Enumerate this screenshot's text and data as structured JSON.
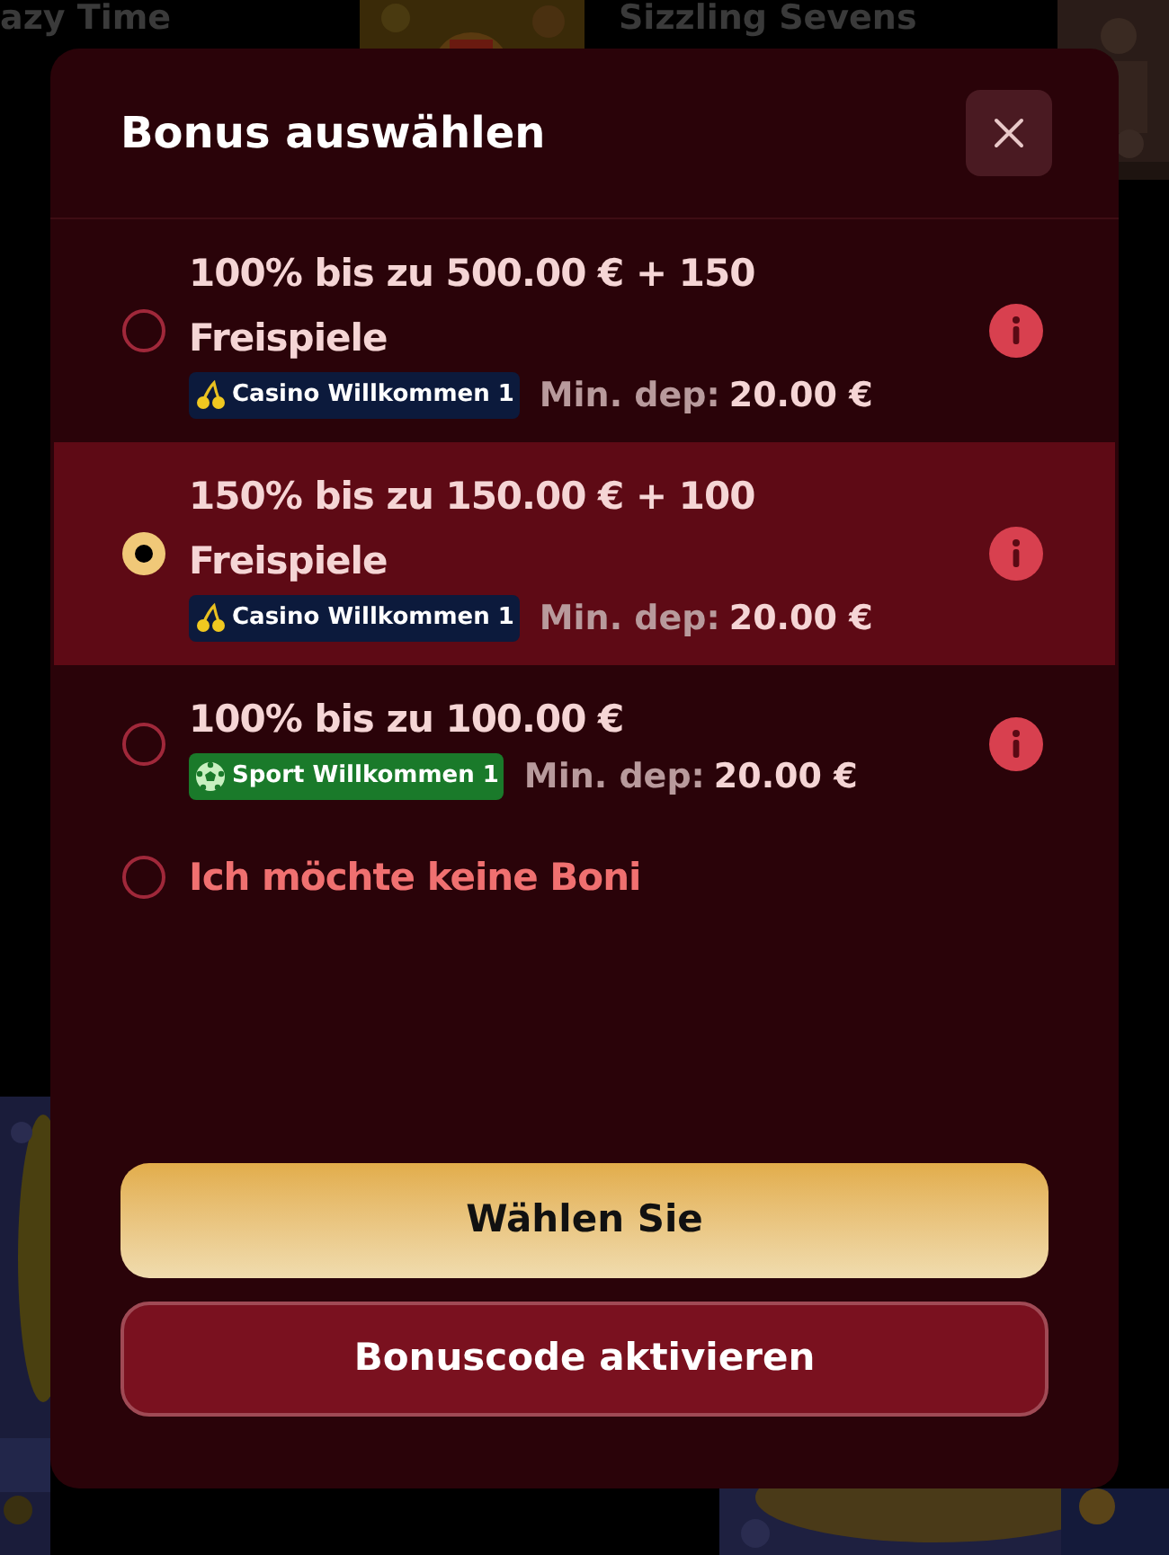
{
  "background": {
    "tiles": [
      {
        "title": "azy Time"
      },
      {
        "title": "Sizzling Sevens"
      }
    ]
  },
  "dialog": {
    "title": "Bonus auswählen",
    "options": [
      {
        "kind": "bonus",
        "selected": false,
        "title": "100% bis zu 500.00 € + 150 Freispiele",
        "tag": {
          "kind": "casino",
          "label": "Casino Willkommen 1"
        },
        "min_deposit_label": "Min. dep:",
        "min_deposit": "20.00 €"
      },
      {
        "kind": "bonus",
        "selected": true,
        "title": "150% bis zu 150.00 € + 100 Freispiele",
        "tag": {
          "kind": "casino",
          "label": "Casino Willkommen 1"
        },
        "min_deposit_label": "Min. dep:",
        "min_deposit": "20.00 €"
      },
      {
        "kind": "bonus",
        "selected": false,
        "title": "100% bis zu 100.00 €",
        "tag": {
          "kind": "sport",
          "label": "Sport Willkommen 1"
        },
        "min_deposit_label": "Min. dep:",
        "min_deposit": "20.00 €"
      },
      {
        "kind": "none",
        "selected": false,
        "title": "Ich möchte keine Boni"
      }
    ],
    "buttons": [
      {
        "kind": "primary",
        "label": "Wählen Sie"
      },
      {
        "kind": "secondary",
        "label": "Bonuscode aktivieren"
      }
    ]
  }
}
